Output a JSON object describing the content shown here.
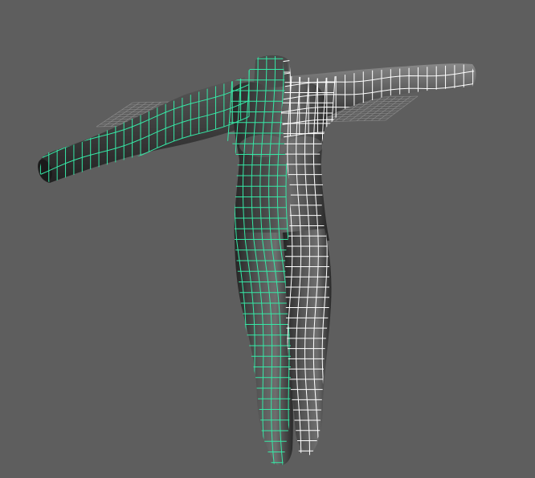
{
  "viewport": {
    "background": "#5e5e5e",
    "wire_selected_color": "#36e8a6",
    "wire_unselected_color": "#ffffff",
    "shade_dark": "#2c2c2c",
    "shade_light": "#7a7a7a",
    "grid_color": "#8e8e8e",
    "mode": "wireframe-on-shaded",
    "selection": "left-half-mesh"
  }
}
